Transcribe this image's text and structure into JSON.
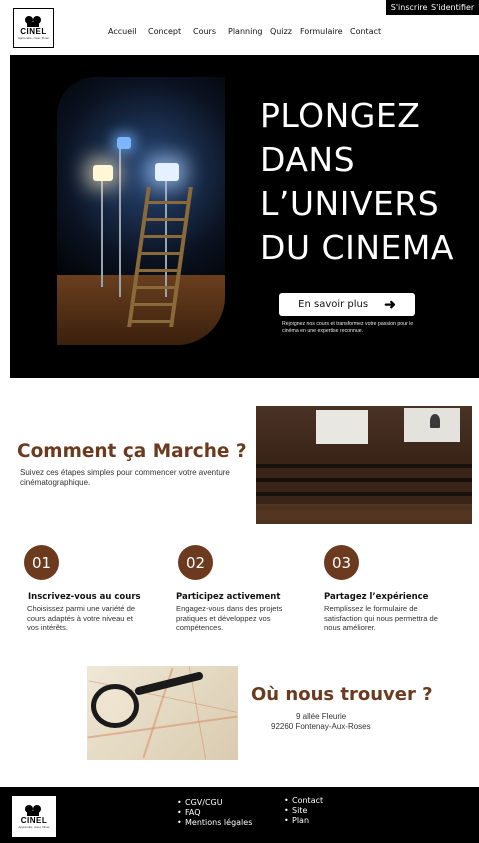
{
  "auth": {
    "signup": "S'inscrire",
    "login": "S'identifier"
  },
  "brand": {
    "name": "CINEL",
    "tagline": "Apprendre, créer, filmer"
  },
  "nav": [
    "Accueil",
    "Concept",
    "Cours",
    "Planning",
    "Quizz",
    "Formulaire",
    "Contact"
  ],
  "hero": {
    "title_lines": [
      "PLONGEZ",
      "DANS",
      "L’UNIVERS",
      "DU CINEMA"
    ],
    "cta_label": "En savoir plus",
    "subtext": "Rejoignez nos cours et transformez votre passion pour le cinéma en une expertise reconnue."
  },
  "how": {
    "title": "Comment ça Marche ?",
    "subtitle": "Suivez ces étapes simples pour commencer votre aventure cinématographique."
  },
  "steps": [
    {
      "num": "01",
      "title": "Inscrivez-vous au cours",
      "text": "Choisissez parmi une variété de cours adaptés à votre niveau et vos intérêts."
    },
    {
      "num": "02",
      "title": "Participez activement",
      "text": "Engagez-vous dans des projets pratiques et développez vos compétences."
    },
    {
      "num": "03",
      "title": "Partagez l’expérience",
      "text": "Remplissez le formulaire de satisfaction qui nous permettra de nous améliorer."
    }
  ],
  "location": {
    "title": "Où nous trouver ?",
    "address_line1": "9 allée Fleurie",
    "address_line2": "92260 Fontenay-Aux-Roses"
  },
  "footer": {
    "col1": [
      "CGV/CGU",
      "FAQ",
      "Mentions légales"
    ],
    "col2": [
      "Contact",
      "Site",
      "Plan"
    ]
  },
  "colors": {
    "accent": "#6b3a1f",
    "dark": "#000000",
    "light": "#ffffff"
  }
}
